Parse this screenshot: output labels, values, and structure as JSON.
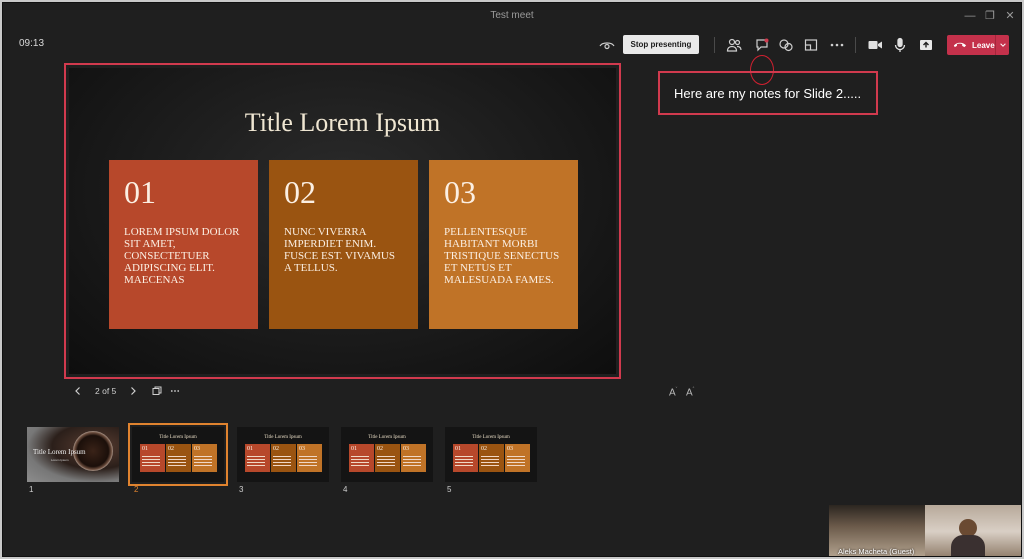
{
  "window": {
    "title": "Test meet"
  },
  "toolbar": {
    "timer": "09:13",
    "stop_presenting": "Stop presenting",
    "leave": "Leave",
    "icons": [
      "eye-icon",
      "people-icon",
      "chat-icon",
      "reactions-icon",
      "rooms-icon",
      "more-icon",
      "camera-icon",
      "mic-icon",
      "share-icon",
      "phone-icon"
    ]
  },
  "slide": {
    "title": "Title Lorem Ipsum",
    "boxes": [
      {
        "num": "01",
        "text": "LOREM IPSUM DOLOR SIT AMET, CONSECTETUER ADIPISCING ELIT. MAECENAS",
        "color": "#b7482b"
      },
      {
        "num": "02",
        "text": "NUNC VIVERRA IMPERDIET ENIM. FUSCE EST. VIVAMUS A TELLUS.",
        "color": "#9a5411"
      },
      {
        "num": "03",
        "text": "PELLENTESQUE HABITANT MORBI TRISTIQUE SENECTUS ET NETUS ET MALESUADA FAMES.",
        "color": "#c07327"
      }
    ]
  },
  "notes": {
    "text": "Here are my notes for Slide 2....."
  },
  "nav": {
    "counter": "2 of 5",
    "font_decrease": "A",
    "font_increase": "A"
  },
  "thumbnails": {
    "selected_index": 1,
    "items": [
      {
        "number": "1",
        "title": "Title Lorem Ipsum",
        "subtitle": "Lorem Ipsum"
      },
      {
        "number": "2",
        "title": "Title Lorem Ipsum"
      },
      {
        "number": "3",
        "title": "Title Lorem Ipsum"
      },
      {
        "number": "4",
        "title": "Title Lorem Ipsum"
      },
      {
        "number": "5",
        "title": "Title Lorem Ipsum"
      }
    ],
    "box_nums": [
      "01",
      "02",
      "03"
    ]
  },
  "participant": {
    "name": "Aleks Macheta (Guest)"
  },
  "colors": {
    "accent_red": "#d13a4e",
    "leave_red": "#c4314b",
    "thumb_selected": "#e0832f"
  }
}
